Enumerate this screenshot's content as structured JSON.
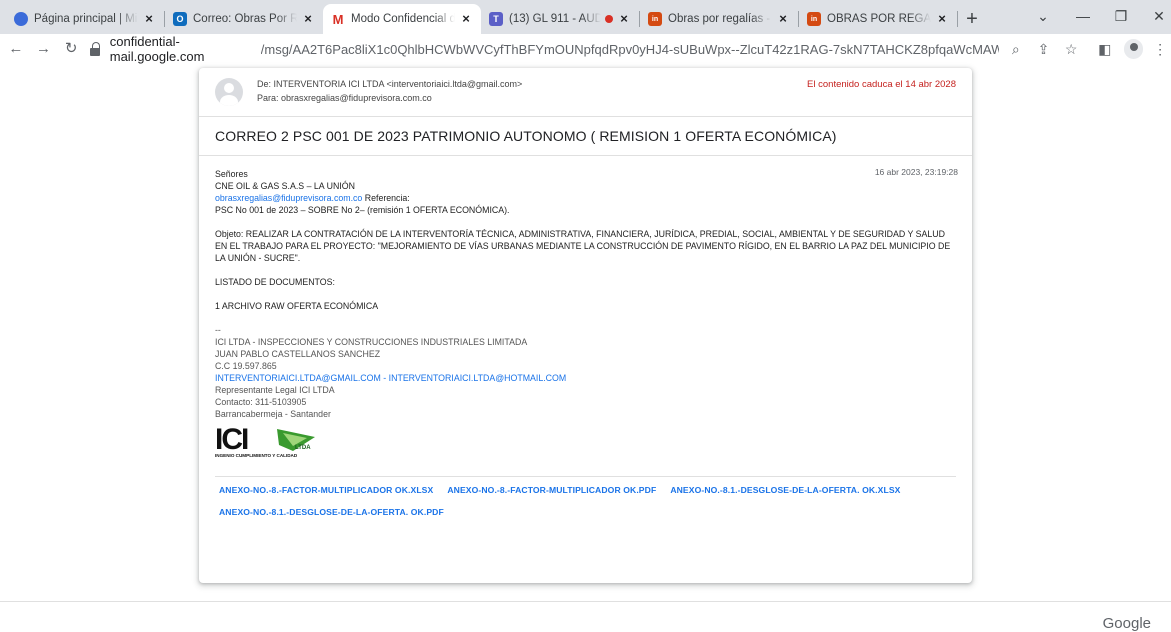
{
  "browser": {
    "tabs": [
      {
        "title": "Página principal | Micr",
        "favicon_color": "#3b6bd9",
        "favicon_glyph": ""
      },
      {
        "title": "Correo: Obras Por Reg",
        "favicon_color": "#0f6cbd",
        "favicon_glyph": "O"
      },
      {
        "title": "Modo Confidencial de",
        "favicon_color": "#ffffff",
        "favicon_glyph": "M"
      },
      {
        "title": "(13) GL 911 - AUD",
        "favicon_color": "#5b5fc7",
        "favicon_glyph": "T"
      },
      {
        "title": "Obras por regalías - F",
        "favicon_color": "#d44a12",
        "favicon_glyph": "in"
      },
      {
        "title": "OBRAS POR REGALÍAS",
        "favicon_color": "#d44a12",
        "favicon_glyph": "in"
      }
    ],
    "new_tab": "+",
    "window_controls": {
      "dropdown": "⌄",
      "minimize": "—",
      "restore": "❐",
      "close": "✕"
    },
    "url_domain": "confidential-mail.google.com",
    "url_path": "/msg/AA2T6Pac8liX1c0QhlbHCWbWVCyfThBFYmOUNpfqdRpv0yHJ4-sUBuWpx--ZlcuT42z1RAG-7skN7TAHCKZ8pfqaWcMAWpCqllEs3..."
  },
  "email": {
    "from": "De: INTERVENTORIA ICI LTDA <interventoriaici.ltda@gmail.com>",
    "to": "Para: obrasxregalias@fiduprevisora.com.co",
    "expiry": "El contenido caduca el 14 abr 2028",
    "subject": "CORREO 2 PSC 001 DE 2023 PATRIMONIO AUTONOMO ( REMISION 1 OFERTA ECONÓMICA)",
    "date": "16 abr 2023, 23:19:28",
    "greeting": "Señores",
    "company": "CNE OIL & GAS S.A.S – LA UNIÓN",
    "ref_email": "obrasxregalias@fiduprevisora.com.co",
    "ref_label": " Referencia:",
    "ref_line": "PSC No 001 de 2023 – SOBRE No 2– (remisión 1 OFERTA ECONÓMICA).",
    "objeto": "Objeto: REALIZAR LA CONTRATACIÓN DE LA INTERVENTORÍA TÉCNICA, ADMINISTRATIVA, FINANCIERA, JURÍDICA, PREDIAL, SOCIAL, AMBIENTAL Y  DE SEGURIDAD Y SALUD EN EL TRABAJO PARA EL PROYECTO: \"MEJORAMIENTO DE VÍAS URBANAS MEDIANTE LA CONSTRUCCIÓN DE PAVIMENTO RÍGIDO, EN EL BARRIO LA PAZ DEL MUNICIPIO DE LA UNIÓN - SUCRE\".",
    "listado": "LISTADO DE DOCUMENTOS:",
    "archivo": "1 ARCHIVO RAW OFERTA ECONÓMICA",
    "sig_dash": "--",
    "sig_company": "ICI LTDA - INSPECCIONES Y CONSTRUCCIONES INDUSTRIALES LIMITADA",
    "sig_name": "JUAN PABLO CASTELLANOS SANCHEZ",
    "sig_cc": "C.C 19.597.865",
    "sig_emails": "INTERVENTORIAICI.LTDA@GMAIL.COM - INTERVENTORIAICI.LTDA@HOTMAIL.COM",
    "sig_role": "Representante Legal ICI LTDA",
    "sig_contact": "Contacto: 311-5103905",
    "sig_city": "Barrancabermeja - Santander",
    "logo_text": "ICI",
    "logo_sub": "LTDA",
    "logo_tagline": "INGENIO CUMPLIMIENTO Y CALIDAD",
    "attachments": [
      "ANEXO-NO.-8.-FACTOR-MULTIPLICADOR OK.XLSX",
      "ANEXO-NO.-8.-FACTOR-MULTIPLICADOR OK.PDF",
      "ANEXO-NO.-8.1.-DESGLOSE-DE-LA-OFERTA. OK.XLSX",
      "ANEXO-NO.-8.1.-DESGLOSE-DE-LA-OFERTA. OK.PDF"
    ]
  },
  "footer": {
    "brand": "Google"
  },
  "colors": {
    "link": "#1a73e8",
    "expiry": "#c5221f",
    "logo_green": "#3a9a2f"
  }
}
